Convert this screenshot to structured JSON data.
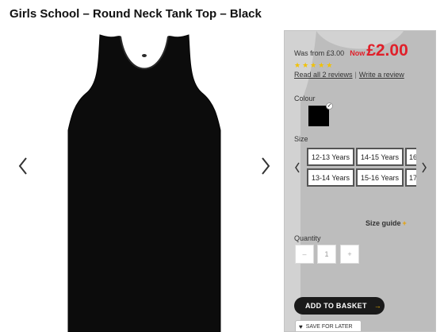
{
  "product": {
    "title": "Girls School – Round Neck Tank Top – Black"
  },
  "pricing": {
    "was_text": "Was from £3.00",
    "now_label": "Now",
    "price": "£2.00"
  },
  "rating": {
    "stars": 5
  },
  "reviews": {
    "read_label": "Read all 2 reviews",
    "separator": "|",
    "write_label": "Write a review"
  },
  "colour": {
    "label": "Colour",
    "swatches": [
      {
        "name": "Black",
        "hex": "#000000",
        "selected": true
      }
    ],
    "check_glyph": "✓"
  },
  "size": {
    "label": "Size",
    "options": [
      "12-13 Years",
      "13-14 Years",
      "14-15 Years",
      "15-16 Years",
      "16",
      "17"
    ]
  },
  "size_guide": {
    "label": "Size guide",
    "plus": "+"
  },
  "quantity": {
    "label": "Quantity",
    "minus": "–",
    "value": "1",
    "plus": "+"
  },
  "actions": {
    "add_to_basket": "ADD TO BASKET",
    "add_arrow": "→",
    "save_for_later": "SAVE FOR LATER"
  },
  "icons": {
    "gallery_prev": "chevron-left-icon",
    "gallery_next": "chevron-right-icon",
    "size_prev": "chevron-left-icon",
    "size_next": "chevron-right-icon",
    "heart": "heart-icon"
  },
  "colors": {
    "price_red": "#e0202a",
    "star_yellow": "#f2c200",
    "panel_grey": "#cfcfcf",
    "button_dark": "#1a1a1a"
  }
}
